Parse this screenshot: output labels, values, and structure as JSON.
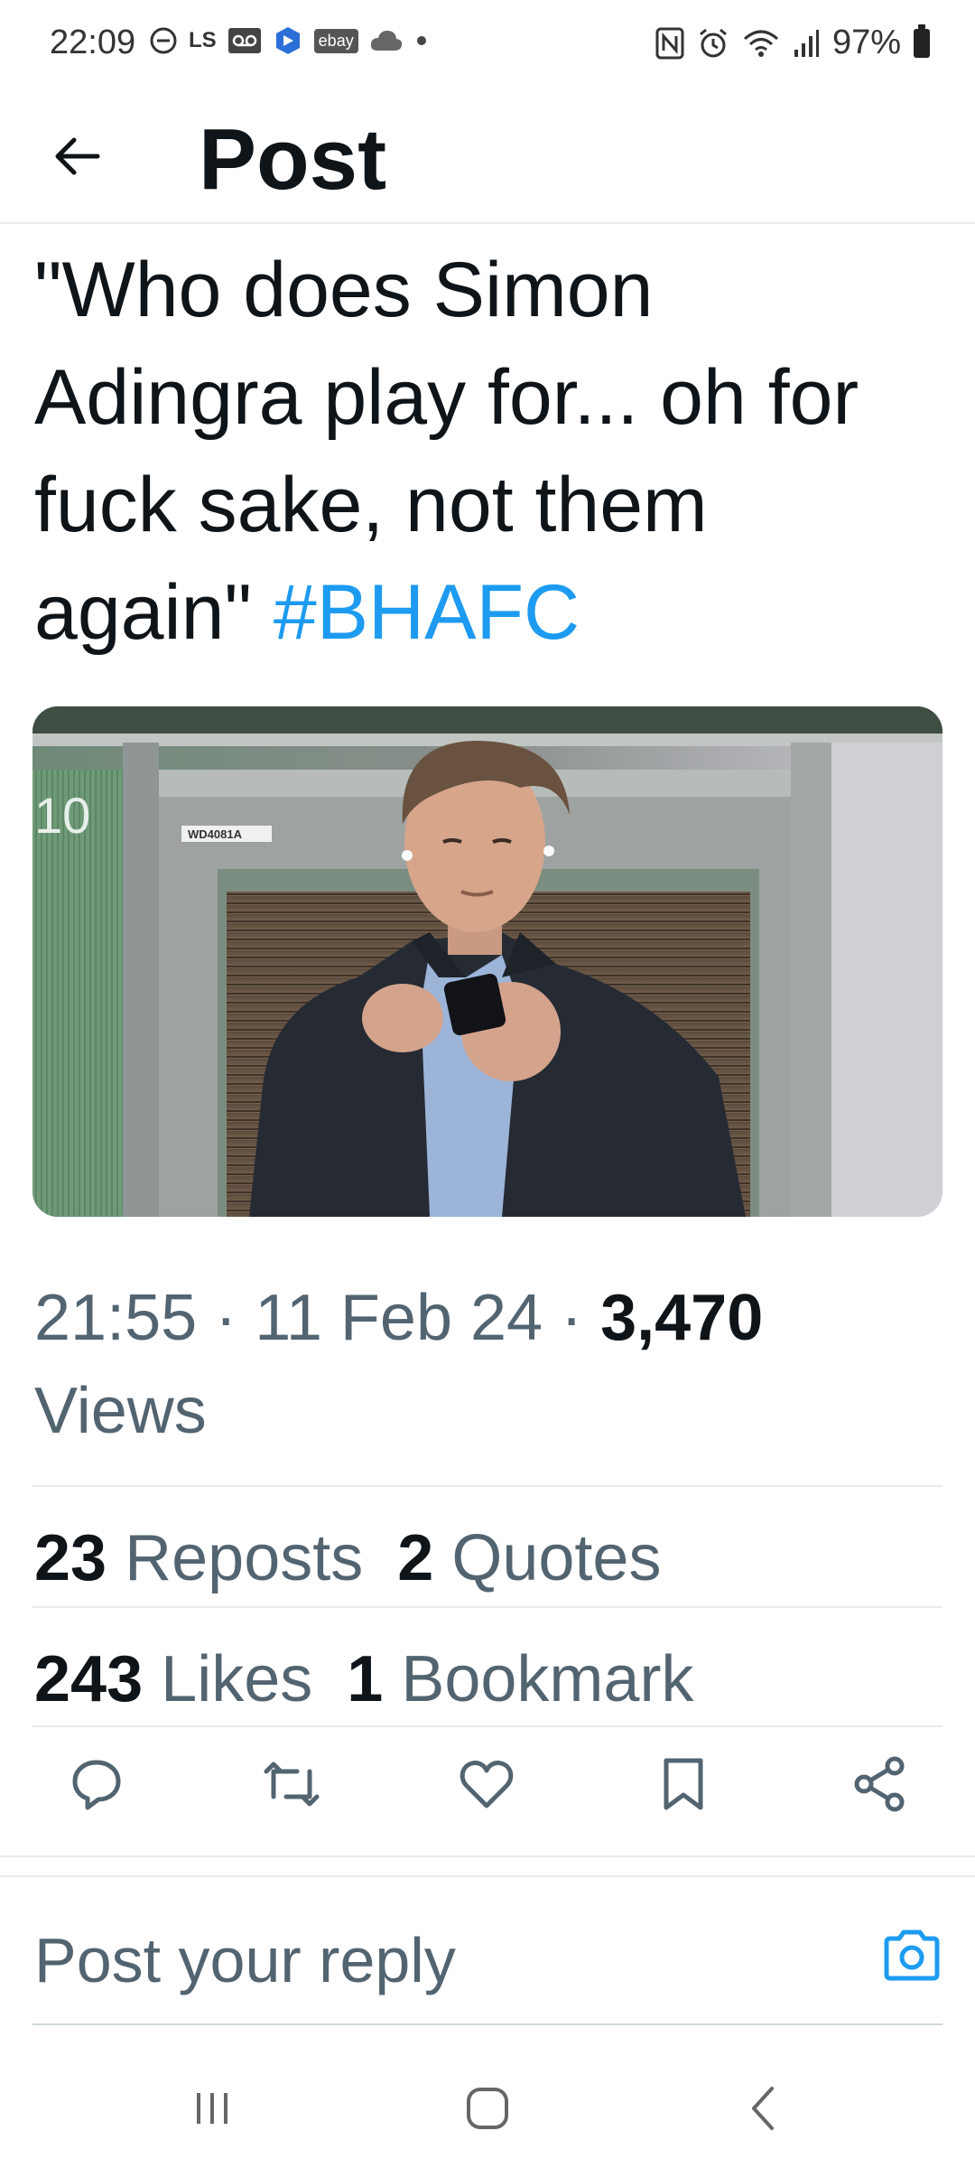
{
  "status_bar": {
    "time": "22:09",
    "battery": "97%",
    "left_icons": [
      "do-not-disturb-icon",
      "ls-icon",
      "voicemail-icon",
      "app-icon",
      "ebay-icon",
      "cloud-icon",
      "dot-icon"
    ],
    "ls_label": "LS",
    "ebay_label": "ebay",
    "right_icons": [
      "nfc-icon",
      "alarm-icon",
      "wifi-icon",
      "signal-icon",
      "battery-icon"
    ]
  },
  "header": {
    "title": "Post"
  },
  "post": {
    "text": "\"Who does Simon Adingra play for... oh for fuck sake, not them again\"",
    "hashtag": "#BHAFC",
    "media": {
      "sign_number": "10",
      "door_label": "WD4081A"
    },
    "time": "21:55",
    "date": "11 Feb 24",
    "views_count": "3,470",
    "views_label": "Views",
    "reposts_count": "23",
    "reposts_label": "Reposts",
    "quotes_count": "2",
    "quotes_label": "Quotes",
    "likes_count": "243",
    "likes_label": "Likes",
    "bookmarks_count": "1",
    "bookmarks_label": "Bookmark"
  },
  "reply": {
    "placeholder": "Post your reply"
  },
  "colors": {
    "accent": "#1d9bf0",
    "text_primary": "#0f1419",
    "text_secondary": "#536471"
  }
}
